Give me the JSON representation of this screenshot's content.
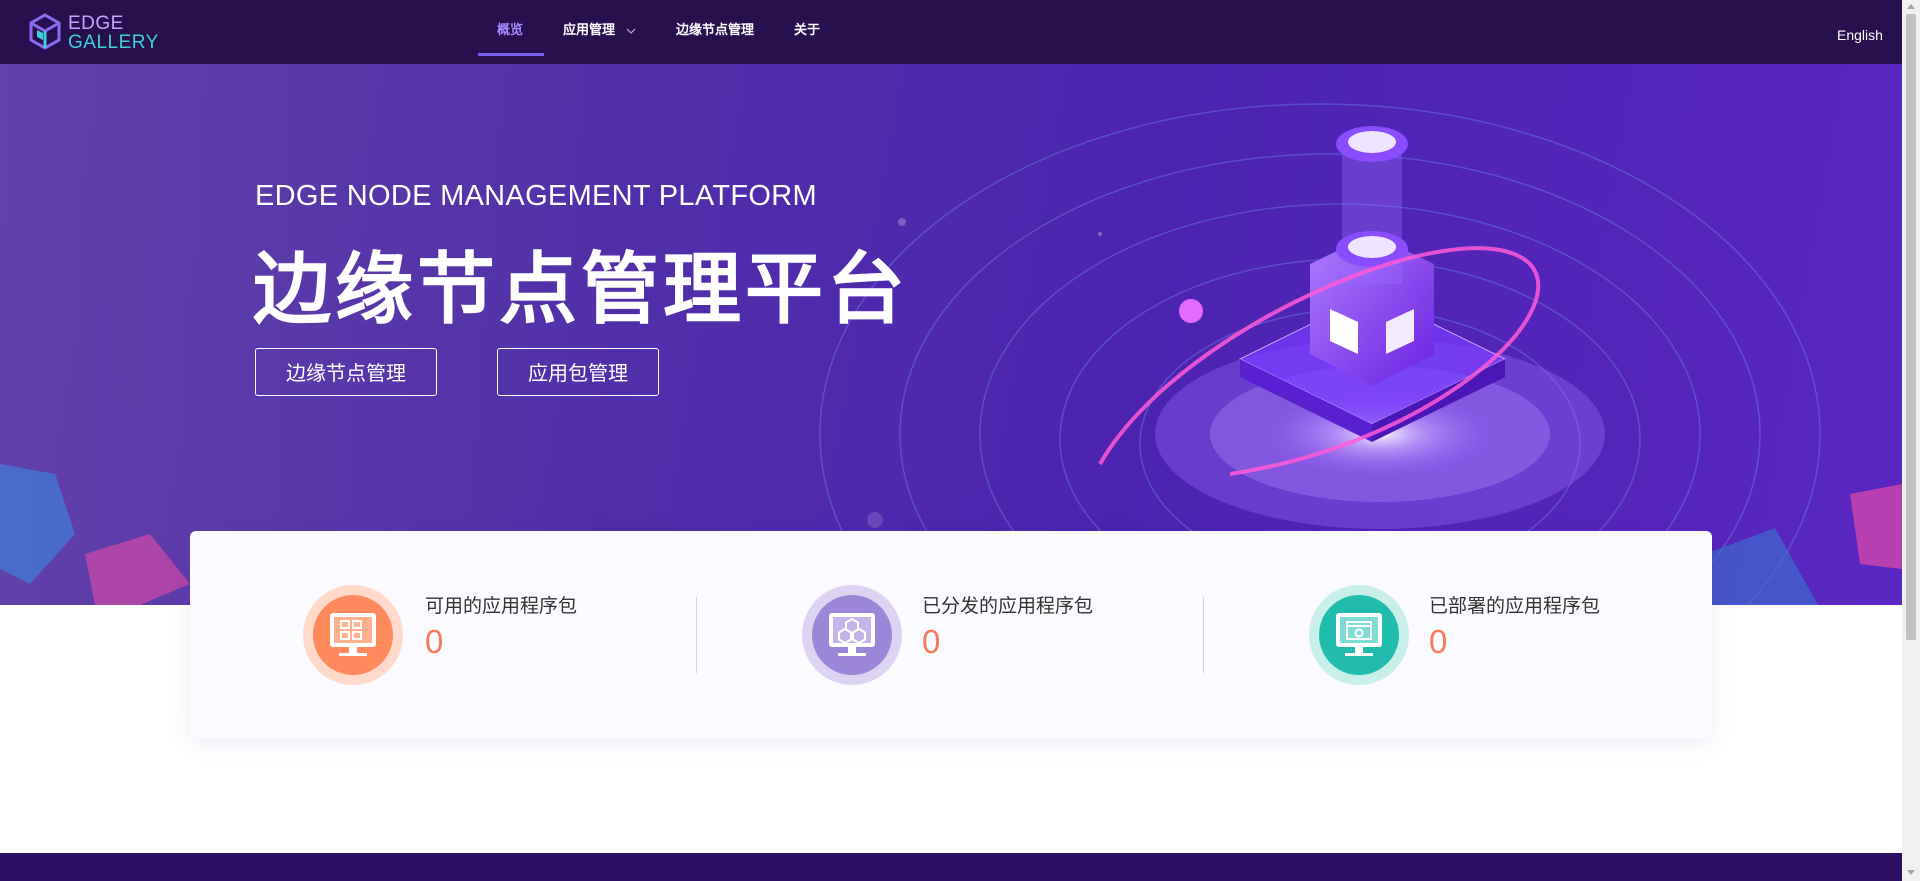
{
  "logo": {
    "line1": "EDGE",
    "line2": "GALLERY"
  },
  "nav": {
    "overview": "概览",
    "app_mgmt": "应用管理",
    "node_mgmt": "边缘节点管理",
    "about": "关于"
  },
  "language_switch": "English",
  "hero": {
    "subtitle": "EDGE NODE MANAGEMENT PLATFORM",
    "title": "边缘节点管理平台",
    "button_nodes": "边缘节点管理",
    "button_packages": "应用包管理"
  },
  "stats": [
    {
      "label": "可用的应用程序包",
      "value": "0",
      "icon": "apps-grid-monitor-icon",
      "color": "#ff8a5c"
    },
    {
      "label": "已分发的应用程序包",
      "value": "0",
      "icon": "hexagon-monitor-icon",
      "color": "#9b86d8"
    },
    {
      "label": "已部署的应用程序包",
      "value": "0",
      "icon": "deploy-window-monitor-icon",
      "color": "#20bcae"
    }
  ],
  "colors": {
    "navbar": "#28104f",
    "accent": "#a98cff",
    "stat_value": "#f57c56",
    "footer": "#2e0f63"
  }
}
